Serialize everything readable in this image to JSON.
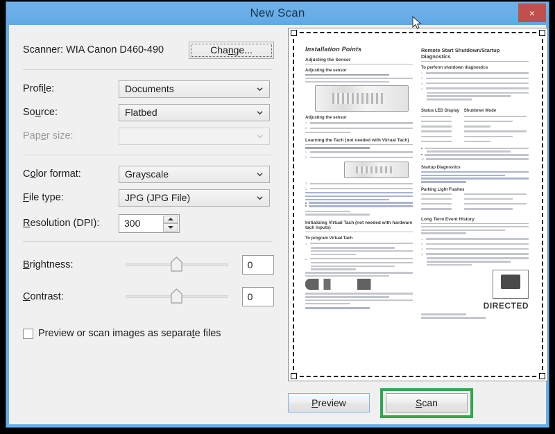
{
  "window": {
    "title": "New Scan",
    "close_label": "×",
    "accent_blue": "#66aee8",
    "close_red": "#c0504d",
    "highlight_green": "#2fa84f"
  },
  "form": {
    "scanner_label": "Scanner: WIA Canon D460-490",
    "change_button": "Change...",
    "fields": [
      {
        "label": "Profile:",
        "label_pre": "Profi",
        "label_accel": "l",
        "label_post": "e:",
        "value": "Documents",
        "disabled": false
      },
      {
        "label": "Source:",
        "label_pre": "So",
        "label_accel": "u",
        "label_post": "rce:",
        "value": "Flatbed",
        "disabled": false
      },
      {
        "label": "Paper size:",
        "label_pre": "Pap",
        "label_accel": "e",
        "label_post": "r size:",
        "value": "",
        "disabled": true
      },
      {
        "label": "Color format:",
        "label_pre": "C",
        "label_accel": "o",
        "label_post": "lor format:",
        "value": "Grayscale",
        "disabled": false
      },
      {
        "label": "File type:",
        "label_pre": "",
        "label_accel": "F",
        "label_post": "ile type:",
        "value": "JPG (JPG File)",
        "disabled": false
      }
    ],
    "resolution": {
      "label_pre": "",
      "label_accel": "R",
      "label_post": "esolution (DPI):",
      "value": "300",
      "spin_up": "spinner-up-icon",
      "spin_down": "spinner-down-icon"
    },
    "brightness": {
      "label_pre": "",
      "label_accel": "B",
      "label_post": "rightness:",
      "value": "0",
      "slider_percent": 50
    },
    "contrast": {
      "label_pre": "",
      "label_accel": "C",
      "label_post": "ontrast:",
      "value": "0",
      "slider_percent": 50
    },
    "checkbox": {
      "text_pre": "Preview or scan images as separa",
      "accel": "t",
      "text_post": "e files",
      "checked": false
    }
  },
  "buttons": {
    "preview": {
      "pre": "",
      "accel": "P",
      "post": "review"
    },
    "scan": {
      "pre": "",
      "accel": "S",
      "post": "can"
    }
  },
  "preview": {
    "doc": {
      "left_column": {
        "h1": "Installation Points",
        "h2_a": "Adjusting the Sensor",
        "h2_b": "Learning the Tach (not needed with Virtual Tach)",
        "h2_c": "Initializing Virtual Tach (not needed with hardware tach inputs)"
      },
      "right_column": {
        "h1": "Remote Start Shutdown/Startup Diagnostics",
        "h2_a": "Status LED Display",
        "h2_b": "Shutdown Mode",
        "h2_c": "Startup Diagnostics",
        "h2_d": "Parking Light Flashes",
        "h2_e": "Long Term Event History",
        "logo_text": "DIRECTED"
      }
    }
  },
  "icons": {
    "chevron_down": "chevron-down-icon",
    "cursor": "mouse-pointer-icon"
  }
}
